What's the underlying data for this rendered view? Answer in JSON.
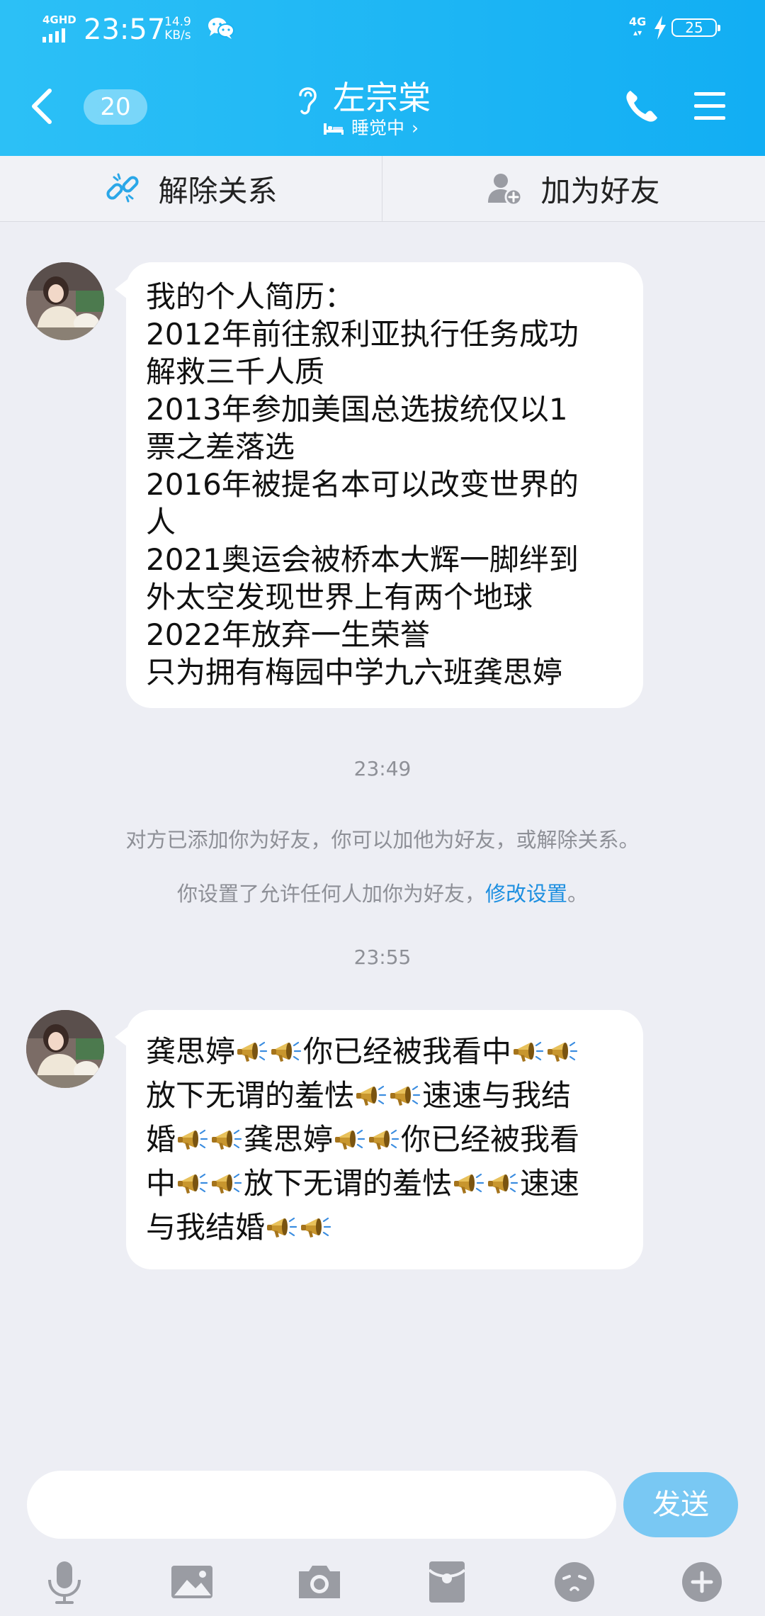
{
  "status_bar": {
    "network": "4GHD",
    "time": "23:57",
    "speed_value": "14.9",
    "speed_unit": "KB/s",
    "right_network": "4G",
    "battery": "25"
  },
  "header": {
    "unread_count": "20",
    "contact_name": "左宗棠",
    "status_text": "睡觉中",
    "status_chevron": "›",
    "colors": {
      "bar_start": "#2cc0f6",
      "bar_end": "#12aef3"
    }
  },
  "actions": {
    "unlink_label": "解除关系",
    "add_friend_label": "加为好友"
  },
  "messages": {
    "first": {
      "lines": [
        "我的个人简历：",
        "2012年前往叙利亚执行任务成功",
        "解救三千人质",
        "2013年参加美国总选拔统仅以1",
        "票之差落选",
        "2016年被提名本可以改变世界的",
        "人",
        "2021奥运会被桥本大辉一脚绊到",
        "外太空发现世界上有两个地球",
        "2022年放弃一生荣誉",
        "只为拥有梅园中学九六班龚思婷"
      ]
    },
    "timestamp_1": "23:49",
    "system_1": "对方已添加你为好友，你可以加他为好友，或解除关系。",
    "system_2_text": "你设置了允许任何人加你为好友，",
    "system_2_link": "修改设置",
    "system_2_end": "。",
    "timestamp_2": "23:55",
    "second": {
      "emoji": "megaphone-emoji",
      "segments": [
        "龚思婷",
        "你已经被我看中",
        "放下无谓的羞怯",
        "速速与我结",
        "婚",
        "龚思婷",
        "你已经被我看",
        "中",
        "放下无谓的羞怯",
        "速速",
        "与我结婚"
      ]
    }
  },
  "input": {
    "value": "",
    "send_label": "发送"
  },
  "toolbar": {
    "icons": [
      "microphone-icon",
      "image-icon",
      "camera-icon",
      "red-packet-icon",
      "emoji-icon",
      "plus-icon"
    ]
  }
}
